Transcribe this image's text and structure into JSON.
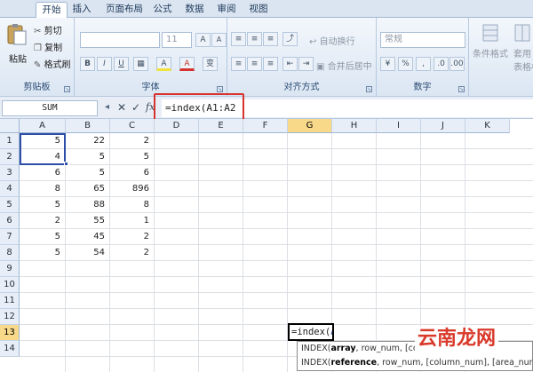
{
  "menu": {
    "tabs": [
      "开始",
      "插入",
      "页面布局",
      "公式",
      "数据",
      "审阅",
      "视图"
    ],
    "active": "开始"
  },
  "ribbon": {
    "clipboard": {
      "paste": "粘贴",
      "cut": "剪切",
      "copy": "复制",
      "format_painter": "格式刷",
      "label": "剪贴板"
    },
    "font": {
      "size": "11",
      "grow": "A",
      "shrink": "A",
      "bold": "B",
      "italic": "I",
      "underline": "U",
      "label": "字体",
      "font_color": "A",
      "fill": "A",
      "more": "变"
    },
    "alignment": {
      "wrap": "自动换行",
      "merge": "合并后居中",
      "label": "对齐方式"
    },
    "number": {
      "format": "常规",
      "label": "数字"
    },
    "styles": {
      "conditional": "条件格式",
      "table": "套用",
      "table2": "表格格"
    }
  },
  "formula_bar": {
    "name_box": "SUM",
    "cancel": "✕",
    "enter": "✓",
    "fx": "fx",
    "formula": "=index(A1:A2"
  },
  "grid": {
    "columns": [
      "A",
      "B",
      "C",
      "D",
      "E",
      "F",
      "G",
      "H",
      "I",
      "J",
      "K"
    ],
    "rows": [
      "1",
      "2",
      "3",
      "4",
      "5",
      "6",
      "7",
      "8",
      "9",
      "10",
      "11",
      "12",
      "13",
      "14"
    ],
    "data": [
      [
        "5",
        "22",
        "2"
      ],
      [
        "4",
        "5",
        "5"
      ],
      [
        "6",
        "5",
        "6"
      ],
      [
        "8",
        "65",
        "896"
      ],
      [
        "5",
        "88",
        "8"
      ],
      [
        "2",
        "55",
        "1"
      ],
      [
        "5",
        "45",
        "2"
      ],
      [
        "5",
        "54",
        "2"
      ]
    ],
    "selected_column": "G",
    "selected_row": "13",
    "edit_cell": {
      "prefix": "=index(",
      "range": "A1:A2"
    }
  },
  "tooltip": {
    "line1": {
      "fn": "INDEX(",
      "arg": "array",
      "rest": ", row_num, [colu"
    },
    "line2": {
      "fn": "INDEX(",
      "arg": "reference",
      "rest": ", row_num, [column_num], [area_num])"
    }
  },
  "watermark": "云南龙网"
}
